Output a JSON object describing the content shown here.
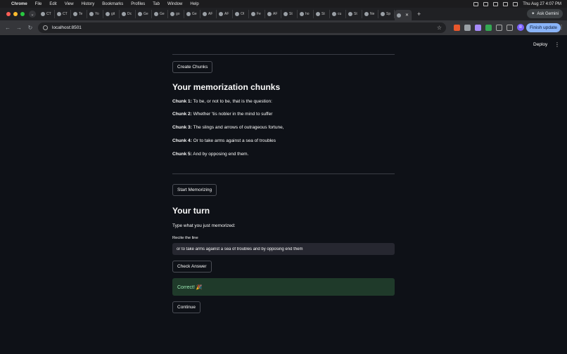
{
  "menubar": {
    "apple": "",
    "items": [
      "Chrome",
      "File",
      "Edit",
      "View",
      "History",
      "Bookmarks",
      "Profiles",
      "Tab",
      "Window",
      "Help"
    ],
    "clock": "Thu Aug 27  4:07 PM"
  },
  "tabs": [
    {
      "label": "CT"
    },
    {
      "label": "CT"
    },
    {
      "label": "Te"
    },
    {
      "label": "Yo"
    },
    {
      "label": "git"
    },
    {
      "label": "Dc"
    },
    {
      "label": "Ge"
    },
    {
      "label": "Ge"
    },
    {
      "label": "go"
    },
    {
      "label": "Ge"
    },
    {
      "label": "AF"
    },
    {
      "label": "AF"
    },
    {
      "label": "OI"
    },
    {
      "label": "Fe"
    },
    {
      "label": "AF"
    },
    {
      "label": "St"
    },
    {
      "label": "ho"
    },
    {
      "label": "St"
    },
    {
      "label": "cu"
    },
    {
      "label": "St"
    },
    {
      "label": "Ne"
    },
    {
      "label": "Sp"
    },
    {
      "label": ""
    }
  ],
  "active_tab_close": "✕",
  "new_tab": "+",
  "ask_gemini": "Ask Gemini",
  "toolbar": {
    "url": "localhost:8501",
    "profile_initial": "R",
    "finish_update": "Finish update"
  },
  "app": {
    "deploy": "Deploy",
    "create_chunks": "Create Chunks",
    "chunks_heading": "Your memorization chunks",
    "chunks": [
      {
        "label": "Chunk 1:",
        "text": " To be, or not to be, that is the question:"
      },
      {
        "label": "Chunk 2:",
        "text": " Whether 'tis nobler in the mind to suffer"
      },
      {
        "label": "Chunk 3:",
        "text": " The slings and arrows of outrageous fortune,"
      },
      {
        "label": "Chunk 4:",
        "text": " Or to take arms against a sea of troubles"
      },
      {
        "label": "Chunk 5:",
        "text": " And by opposing end them."
      }
    ],
    "start_memorizing": "Start Memorizing",
    "turn_heading": "Your turn",
    "instruction": "Type what you just memorized:",
    "recite_label": "Recite the line",
    "recite_value": "or to take arms against a sea of troubles and by opposing end them",
    "check_answer": "Check Answer",
    "success": "Correct! 🎉",
    "continue": "Continue"
  },
  "colors": {
    "background": "#0e1117",
    "success_bg": "#1f3a2a",
    "success_text": "#9be7b3",
    "input_bg": "#262730"
  }
}
